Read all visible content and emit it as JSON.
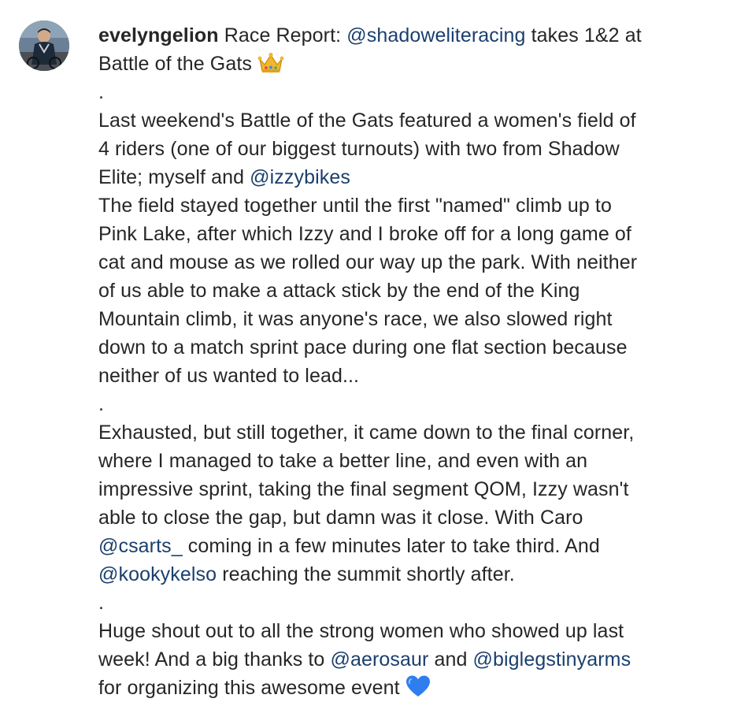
{
  "post": {
    "author": {
      "username": "evelyngelion",
      "avatar_icon": "profile-photo"
    },
    "caption": {
      "title_line1": [
        {
          "type": "text",
          "text": "Race Report: "
        },
        {
          "type": "mention",
          "text": "@shadoweliteracing"
        },
        {
          "type": "text",
          "text": " takes 1&2 at"
        }
      ],
      "lines": [
        [
          {
            "type": "text",
            "text": "Battle of the Gats "
          },
          {
            "type": "emoji",
            "icon": "crown-emoji"
          }
        ],
        [
          {
            "type": "text",
            "text": "."
          }
        ],
        [
          {
            "type": "text",
            "text": "Last weekend's Battle of the Gats featured a women's field of"
          }
        ],
        [
          {
            "type": "text",
            "text": "4 riders (one of our biggest turnouts) with two from Shadow"
          }
        ],
        [
          {
            "type": "text",
            "text": "Elite; myself and "
          },
          {
            "type": "mention",
            "text": "@izzybikes"
          }
        ],
        [
          {
            "type": "text",
            "text": "The field stayed together until the first \"named\" climb up to"
          }
        ],
        [
          {
            "type": "text",
            "text": "Pink Lake, after which Izzy and I broke off for a long game of"
          }
        ],
        [
          {
            "type": "text",
            "text": "cat and mouse as we rolled our way up the park. With neither"
          }
        ],
        [
          {
            "type": "text",
            "text": "of us able to make a attack stick by the end of the King"
          }
        ],
        [
          {
            "type": "text",
            "text": "Mountain climb, it was anyone's race, we also slowed right"
          }
        ],
        [
          {
            "type": "text",
            "text": "down to a match sprint pace during one flat section because"
          }
        ],
        [
          {
            "type": "text",
            "text": "neither of us wanted to lead..."
          }
        ],
        [
          {
            "type": "text",
            "text": "."
          }
        ],
        [
          {
            "type": "text",
            "text": "Exhausted, but still together, it came down to the final corner,"
          }
        ],
        [
          {
            "type": "text",
            "text": "where I managed to take a better line, and even with an"
          }
        ],
        [
          {
            "type": "text",
            "text": "impressive sprint, taking the final segment QOM, Izzy wasn't"
          }
        ],
        [
          {
            "type": "text",
            "text": "able to close the gap, but damn was it close. With Caro"
          }
        ],
        [
          {
            "type": "mention",
            "text": "@csarts_"
          },
          {
            "type": "text",
            "text": " coming in a few minutes later to take third. And"
          }
        ],
        [
          {
            "type": "mention",
            "text": "@kookykelso"
          },
          {
            "type": "text",
            "text": " reaching the summit shortly after."
          }
        ],
        [
          {
            "type": "text",
            "text": "."
          }
        ],
        [
          {
            "type": "text",
            "text": "Huge shout out to all the strong women who showed up last"
          }
        ],
        [
          {
            "type": "text",
            "text": "week! And a big thanks to "
          },
          {
            "type": "mention",
            "text": "@aerosaur"
          },
          {
            "type": "text",
            "text": " and "
          },
          {
            "type": "mention",
            "text": "@biglegstinyarms"
          }
        ],
        [
          {
            "type": "text",
            "text": "for organizing this awesome event "
          },
          {
            "type": "emoji",
            "icon": "blue-heart-emoji"
          }
        ]
      ]
    }
  },
  "colors": {
    "text": "#262626",
    "mention": "#1b3f6e",
    "background": "#ffffff"
  }
}
